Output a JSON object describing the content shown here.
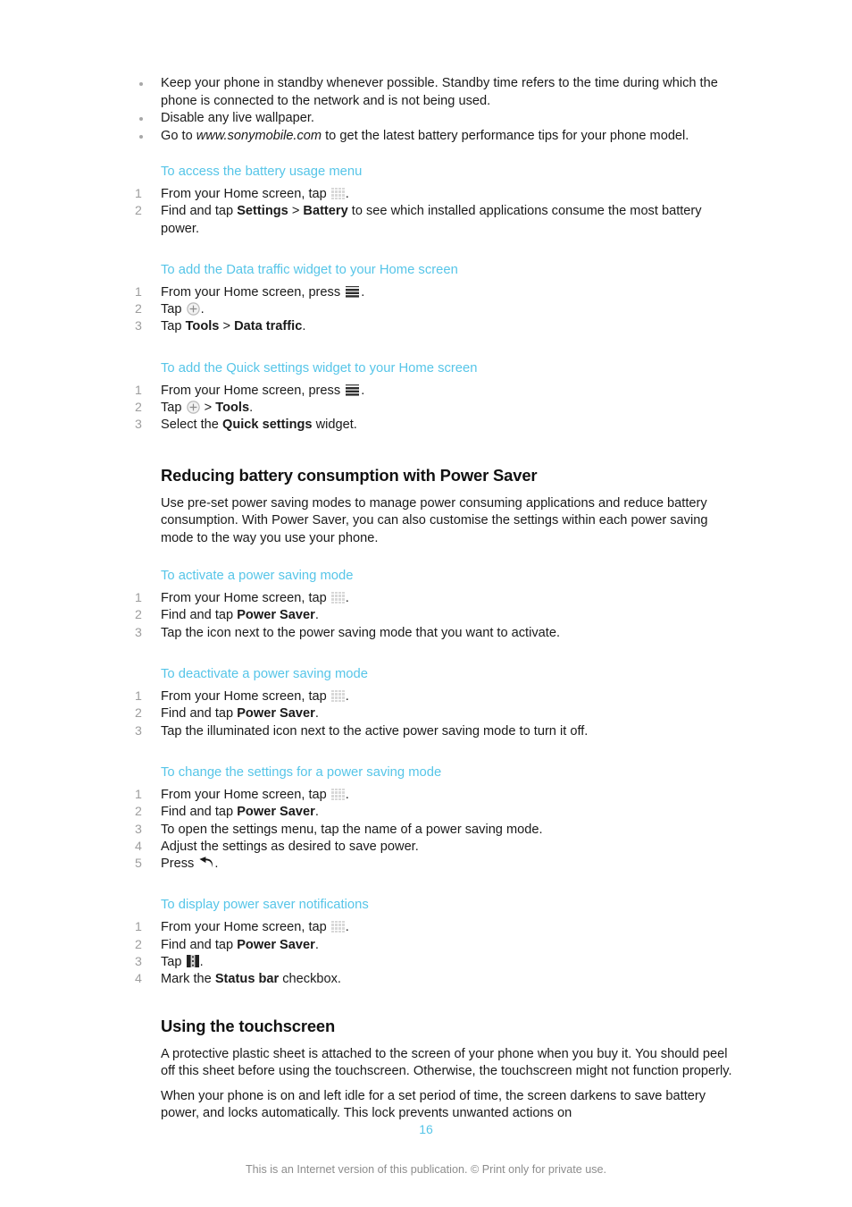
{
  "document": {
    "page_number": "16",
    "footer_note": "This is an Internet version of this publication. © Print only for private use."
  },
  "bullets": [
    "Keep your phone in standby whenever possible. Standby time refers to the time during which the phone is connected to the network and is not being used.",
    "Disable any live wallpaper."
  ],
  "bullet_sonymobile": {
    "prefix": "Go to ",
    "url": "www.sonymobile.com",
    "suffix": " to get the latest battery performance tips for your phone model."
  },
  "procedures": {
    "battery_usage": {
      "heading": "To access the battery usage menu",
      "step1_prefix": "From your Home screen, tap ",
      "step1_icon": "app-drawer-grid-icon",
      "step1_suffix": ".",
      "step2_a": "Find and tap ",
      "step2_b": "Settings",
      "step2_c": " > ",
      "step2_d": "Battery",
      "step2_e": " to see which installed applications consume the most battery power."
    },
    "data_traffic_widget": {
      "heading": "To add the Data traffic widget to your Home screen",
      "step1_prefix": "From your Home screen, press ",
      "step1_icon": "menu-icon",
      "step1_suffix": ".",
      "step2_prefix": "Tap ",
      "step2_icon": "plus-circle-icon",
      "step2_suffix": ".",
      "step3_a": "Tap ",
      "step3_b": "Tools",
      "step3_c": " > ",
      "step3_d": "Data traffic",
      "step3_e": "."
    },
    "quick_settings_widget": {
      "heading": "To add the Quick settings widget to your Home screen",
      "step1_prefix": "From your Home screen, press ",
      "step1_icon": "menu-icon",
      "step1_suffix": ".",
      "step2_prefix": "Tap ",
      "step2_icon": "plus-circle-icon",
      "step2_mid": " > ",
      "step2_bold": "Tools",
      "step2_suffix": ".",
      "step3_a": "Select the ",
      "step3_b": "Quick settings",
      "step3_c": " widget."
    },
    "activate_power_saving": {
      "heading": "To activate a power saving mode",
      "step1_prefix": "From your Home screen, tap ",
      "step1_icon": "app-drawer-grid-icon",
      "step1_suffix": ".",
      "step2_a": "Find and tap ",
      "step2_b": "Power Saver",
      "step2_c": ".",
      "step3": "Tap the icon next to the power saving mode that you want to activate."
    },
    "deactivate_power_saving": {
      "heading": "To deactivate a power saving mode",
      "step1_prefix": "From your Home screen, tap ",
      "step1_icon": "app-drawer-grid-icon",
      "step1_suffix": ".",
      "step2_a": "Find and tap ",
      "step2_b": "Power Saver",
      "step2_c": ".",
      "step3": "Tap the illuminated icon next to the active power saving mode to turn it off."
    },
    "change_power_saving": {
      "heading": "To change the settings for a power saving mode",
      "step1_prefix": "From your Home screen, tap ",
      "step1_icon": "app-drawer-grid-icon",
      "step1_suffix": ".",
      "step2_a": "Find and tap ",
      "step2_b": "Power Saver",
      "step2_c": ".",
      "step3": "To open the settings menu, tap the name of a power saving mode.",
      "step4": "Adjust the settings as desired to save power.",
      "step5_prefix": "Press ",
      "step5_icon": "back-arrow-icon",
      "step5_suffix": "."
    },
    "power_saver_notifications": {
      "heading": "To display power saver notifications",
      "step1_prefix": "From your Home screen, tap ",
      "step1_icon": "app-drawer-grid-icon",
      "step1_suffix": ".",
      "step2_a": "Find and tap ",
      "step2_b": "Power Saver",
      "step2_c": ".",
      "step3_prefix": "Tap ",
      "step3_icon": "options-square-icon",
      "step3_suffix": ".",
      "step4_a": "Mark the ",
      "step4_b": "Status bar",
      "step4_c": " checkbox."
    }
  },
  "sections": {
    "power_saver": {
      "heading": "Reducing battery consumption with Power Saver",
      "body": "Use pre-set power saving modes to manage power consuming applications and reduce battery consumption. With Power Saver, you can also customise the settings within each power saving mode to the way you use your phone."
    },
    "touchscreen": {
      "heading": "Using the touchscreen",
      "body1": "A protective plastic sheet is attached to the screen of your phone when you buy it. You should peel off this sheet before using the touchscreen. Otherwise, the touchscreen might not function properly.",
      "body2": "When your phone is on and left idle for a set period of time, the screen darkens to save battery power, and locks automatically. This lock prevents unwanted actions on"
    }
  },
  "step_numbers": {
    "n1": "1",
    "n2": "2",
    "n3": "3",
    "n4": "4",
    "n5": "5"
  },
  "colors": {
    "heading_blue": "#56c5e8",
    "step_number_gray": "#9d9d9d",
    "body_black": "#1a1a1a",
    "footer_gray": "#8d8d8d"
  }
}
